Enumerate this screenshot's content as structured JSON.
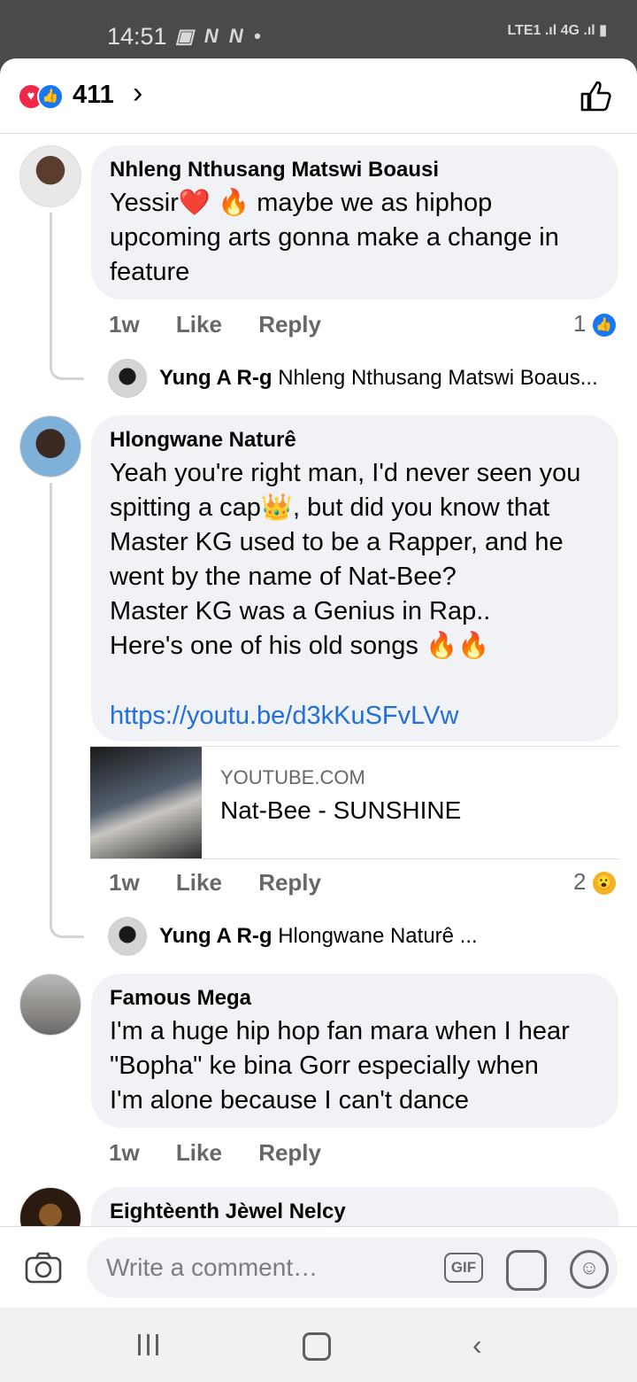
{
  "status": {
    "time": "14:51",
    "left_icons": "▣ N N •",
    "right_icons": "LTE1 .ıl 4G .ıl ▮"
  },
  "header": {
    "reaction_count": "411",
    "chevron": "›"
  },
  "comments": [
    {
      "name": "Nhleng Nthusang Matswi Boausi",
      "text": "Yessir❤️ 🔥 maybe we as hiphop\nupcoming arts gonna make a change in\nfeature",
      "time": "1w",
      "like": "Like",
      "reply": "Reply",
      "reaction_count": "1",
      "reaction_icon": "like-icon",
      "reply_preview": {
        "author": "Yung A R-g",
        "text": "Nhleng Nthusang Matswi Boaus..."
      }
    },
    {
      "name": "Hlongwane Naturê",
      "text": "Yeah you're right man, I'd never seen you\nspitting a cap👑, but did you know that\nMaster KG used to be a Rapper, and he\nwent by the name of Nat-Bee?\nMaster KG was a Genius in Rap..\nHere's one of his old songs 🔥🔥",
      "link": "https://youtu.be/d3kKuSFvLVw",
      "preview": {
        "domain": "YOUTUBE.COM",
        "title": "Nat-Bee - SUNSHINE"
      },
      "time": "1w",
      "like": "Like",
      "reply": "Reply",
      "reaction_count": "2",
      "reaction_icon": "wow-icon",
      "reply_preview": {
        "author": "Yung A R-g",
        "text": "Hlongwane Naturê ..."
      }
    },
    {
      "name": "Famous Mega",
      "text": "I'm a huge hip hop fan mara when I hear\n\"Bopha\" ke bina Gorr especially when\nI'm alone because I can't dance",
      "time": "1w",
      "like": "Like",
      "reply": "Reply"
    },
    {
      "name": "Eightèenth Jèwel Nelcy"
    }
  ],
  "composer": {
    "placeholder": "Write a comment…",
    "gif_label": "GIF"
  },
  "colors": {
    "link": "#216fdb",
    "bubble": "#f0f2f5",
    "like_blue": "#1877f2",
    "love_red": "#f02849"
  }
}
